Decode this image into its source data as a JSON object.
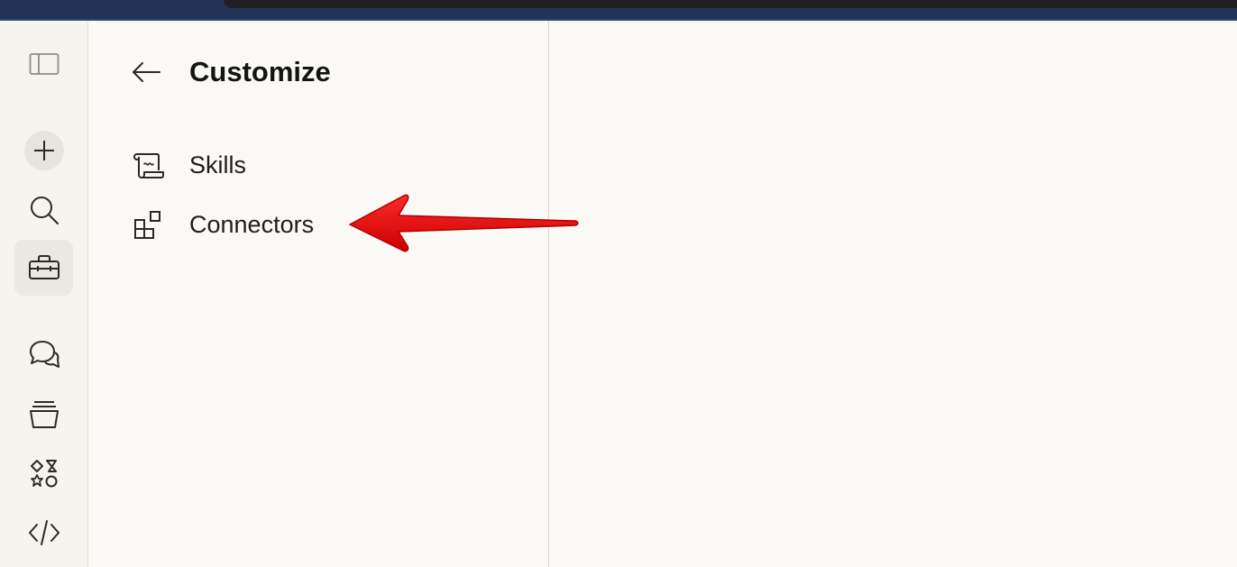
{
  "rail": {
    "items": [
      {
        "name": "sidebar-toggle",
        "icon": "sidebar-toggle-icon"
      },
      {
        "name": "new-chat",
        "icon": "plus-icon"
      },
      {
        "name": "search",
        "icon": "search-icon"
      },
      {
        "name": "customize",
        "icon": "toolbox-icon",
        "active": true
      },
      {
        "name": "chats",
        "icon": "chat-bubbles-icon"
      },
      {
        "name": "projects",
        "icon": "stacked-boxes-icon"
      },
      {
        "name": "artifacts",
        "icon": "shapes-icon"
      },
      {
        "name": "code",
        "icon": "code-icon"
      }
    ]
  },
  "panel": {
    "title": "Customize",
    "back_icon": "arrow-left-icon",
    "items": [
      {
        "label": "Skills",
        "icon": "scroll-icon"
      },
      {
        "label": "Connectors",
        "icon": "connector-blocks-icon"
      }
    ]
  },
  "annotation": {
    "arrow_color": "#e60000",
    "icon": "red-arrow-pointer"
  },
  "colors": {
    "background": "#faf9f6",
    "rail_background": "#f5f4ef",
    "topbar": "#213457",
    "text": "#141413"
  }
}
